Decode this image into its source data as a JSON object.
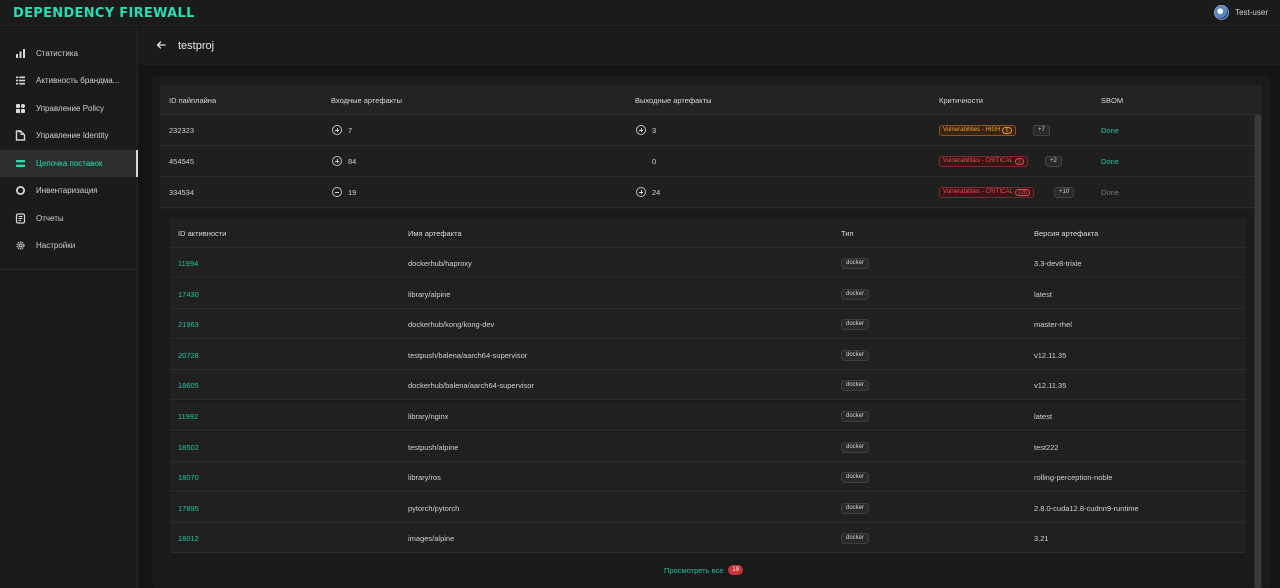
{
  "app": {
    "title": "DEPENDENCY FIREWALL"
  },
  "user": {
    "name": "Test-user"
  },
  "sidebar": {
    "items": [
      {
        "label": "Статистика",
        "icon": "bar-chart-icon"
      },
      {
        "label": "Активность брандма...",
        "icon": "list-activity-icon"
      },
      {
        "label": "Управление Policy",
        "icon": "grid-policy-icon"
      },
      {
        "label": "Управление Identity",
        "icon": "identity-doc-icon"
      },
      {
        "label": "Цепочка поставок",
        "icon": "supply-chain-icon",
        "active": true
      },
      {
        "label": "Инвентаризация",
        "icon": "inventory-circle-icon"
      },
      {
        "label": "Отчеты",
        "icon": "report-icon"
      },
      {
        "label": "Настройки",
        "icon": "gear-icon"
      }
    ]
  },
  "page": {
    "title": "testproj"
  },
  "pipelines": {
    "headers": [
      "ID пайплайна",
      "Входные артефакты",
      "Выходные артефакты",
      "Критичности",
      "SBOM"
    ],
    "rows": [
      {
        "id": "232323",
        "in": "7",
        "in_sign": "plus",
        "out": "3",
        "out_sign": "plus",
        "vuln": "Vulnerabilities - HIGH",
        "vuln_count": "6",
        "severity": "high",
        "more": "+7",
        "sbom": "Done",
        "sbom_state": "done"
      },
      {
        "id": "454545",
        "in": "84",
        "in_sign": "plus",
        "out": "0",
        "out_sign": "none",
        "vuln": "Vulnerabilities - CRITICAL",
        "vuln_count": "1",
        "severity": "critical",
        "more": "+2",
        "sbom": "Done",
        "sbom_state": "done"
      },
      {
        "id": "334534",
        "in": "19",
        "in_sign": "minus",
        "out": "24",
        "out_sign": "plus",
        "vuln": "Vulnerabilities - CRITICAL",
        "vuln_count": "128",
        "severity": "critical",
        "more": "+10",
        "sbom": "Done",
        "sbom_state": "muted"
      }
    ]
  },
  "artifacts": {
    "headers": [
      "ID активности",
      "Имя артефакта",
      "Тип",
      "Версия артефакта"
    ],
    "rows": [
      {
        "id": "11994",
        "name": "dockerhub/haproxy",
        "type": "docker",
        "version": "3.3-dev8-trixie"
      },
      {
        "id": "17430",
        "name": "library/alpine",
        "type": "docker",
        "version": "latest"
      },
      {
        "id": "21963",
        "name": "dockerhub/kong/kong-dev",
        "type": "docker",
        "version": "master-rhel"
      },
      {
        "id": "20728",
        "name": "testpush/balena/aarch64-supervisor",
        "type": "docker",
        "version": "v12.11.35"
      },
      {
        "id": "18605",
        "name": "dockerhub/balena/aarch64-supervisor",
        "type": "docker",
        "version": "v12.11.35"
      },
      {
        "id": "11992",
        "name": "library/nginx",
        "type": "docker",
        "version": "latest"
      },
      {
        "id": "18502",
        "name": "testpush/alpine",
        "type": "docker",
        "version": "test222"
      },
      {
        "id": "18070",
        "name": "library/ros",
        "type": "docker",
        "version": "rolling-perception-noble"
      },
      {
        "id": "17895",
        "name": "pytorch/pytorch",
        "type": "docker",
        "version": "2.8.0-cuda12.8-cudnn9-runtime"
      },
      {
        "id": "18012",
        "name": "images/alpine",
        "type": "docker",
        "version": "3.21"
      }
    ],
    "view_all_label": "Просмотреть все",
    "view_all_count": "19"
  },
  "colors": {
    "accent": "#24e0b0",
    "link": "#24c2a0",
    "high": "#e59a3a",
    "critical": "#e8484f"
  }
}
